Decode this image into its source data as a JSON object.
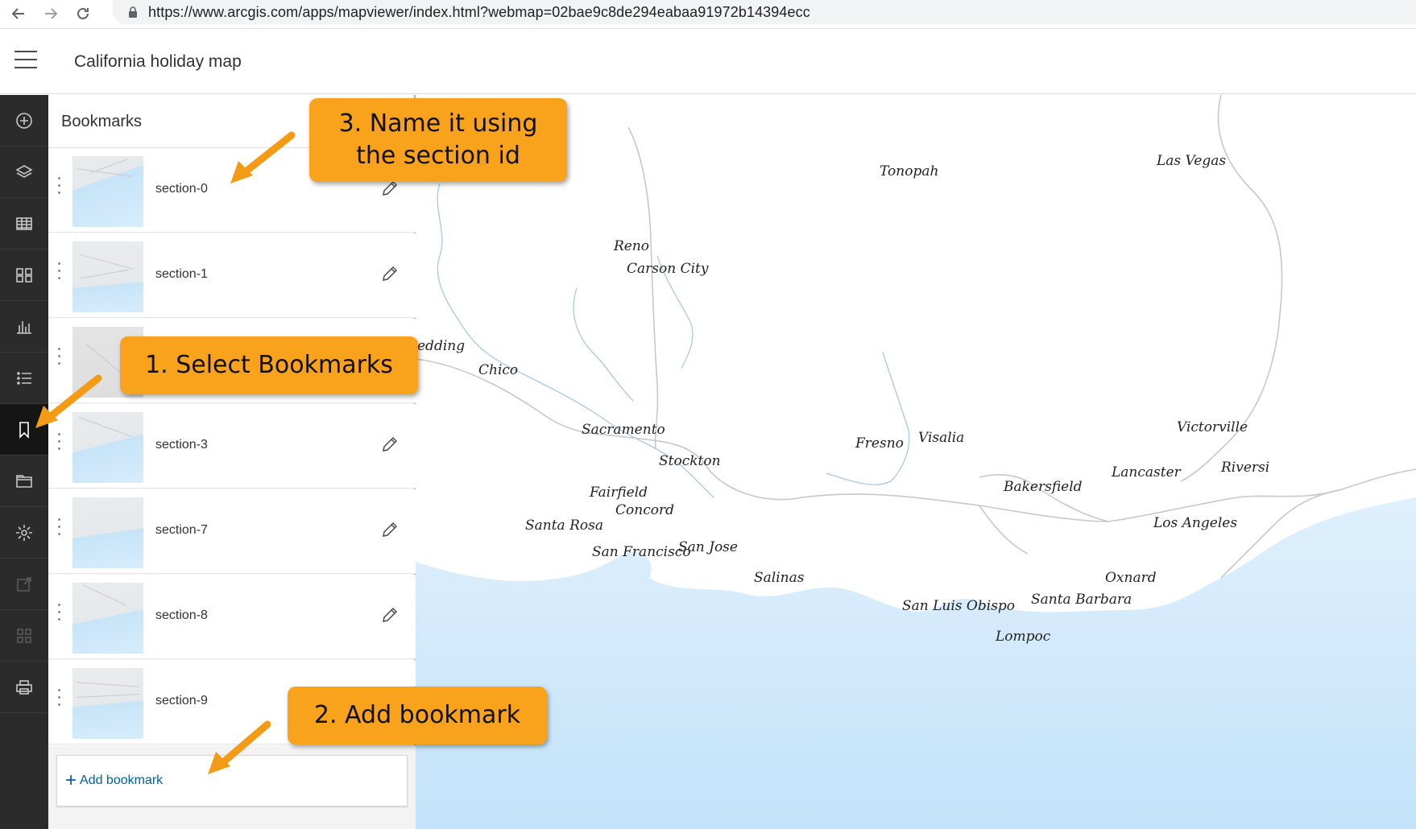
{
  "browser": {
    "url": "https://www.arcgis.com/apps/mapviewer/index.html?webmap=02bae9c8de294eabaa91972b14394ecc",
    "icons": [
      "back-arrow-icon",
      "forward-arrow-icon",
      "reload-icon",
      "lock-icon"
    ]
  },
  "app": {
    "title": "California holiday map"
  },
  "toolbar": {
    "tools": [
      {
        "name": "add-icon",
        "active": false
      },
      {
        "name": "layers-icon",
        "active": false
      },
      {
        "name": "tables-icon",
        "active": false
      },
      {
        "name": "basemap-icon",
        "active": false
      },
      {
        "name": "charts-icon",
        "active": false
      },
      {
        "name": "legend-icon",
        "active": false
      },
      {
        "name": "bookmark-icon",
        "active": true
      },
      {
        "name": "folder-icon",
        "active": false
      },
      {
        "name": "settings-icon",
        "active": false
      },
      {
        "name": "share-icon",
        "active": false
      },
      {
        "name": "grid-icon",
        "active": false
      },
      {
        "name": "print-icon",
        "active": false
      }
    ]
  },
  "panel": {
    "title": "Bookmarks",
    "bookmarks": [
      {
        "name": "section-0"
      },
      {
        "name": "section-1"
      },
      {
        "name": ""
      },
      {
        "name": "section-3"
      },
      {
        "name": "section-7"
      },
      {
        "name": "section-8"
      },
      {
        "name": "section-9"
      }
    ],
    "add_label": "Add bookmark"
  },
  "map": {
    "cities": [
      "Tonopah",
      "Las Vegas",
      "Reno",
      "Carson City",
      "edding",
      "Chico",
      "Sacramento",
      "Stockton",
      "Fresno",
      "Visalia",
      "Victorville",
      "Fairfield",
      "Concord",
      "Lancaster",
      "Riversi",
      "Bakersfield",
      "Santa Rosa",
      "San Jose",
      "San Francisco",
      "Los Angeles",
      "Salinas",
      "Oxnard",
      "San Luis Obispo",
      "Santa Barbara",
      "Lompoc"
    ],
    "water_color": "#cce8fb",
    "road_color": "#c8c8c8",
    "river_color": "#a9c9e4"
  },
  "callouts": {
    "step1": "1. Select Bookmarks",
    "step2": "2. Add bookmark",
    "step3_line1": "3. Name it using",
    "step3_line2": "the section id",
    "color": "#f9a21b"
  }
}
